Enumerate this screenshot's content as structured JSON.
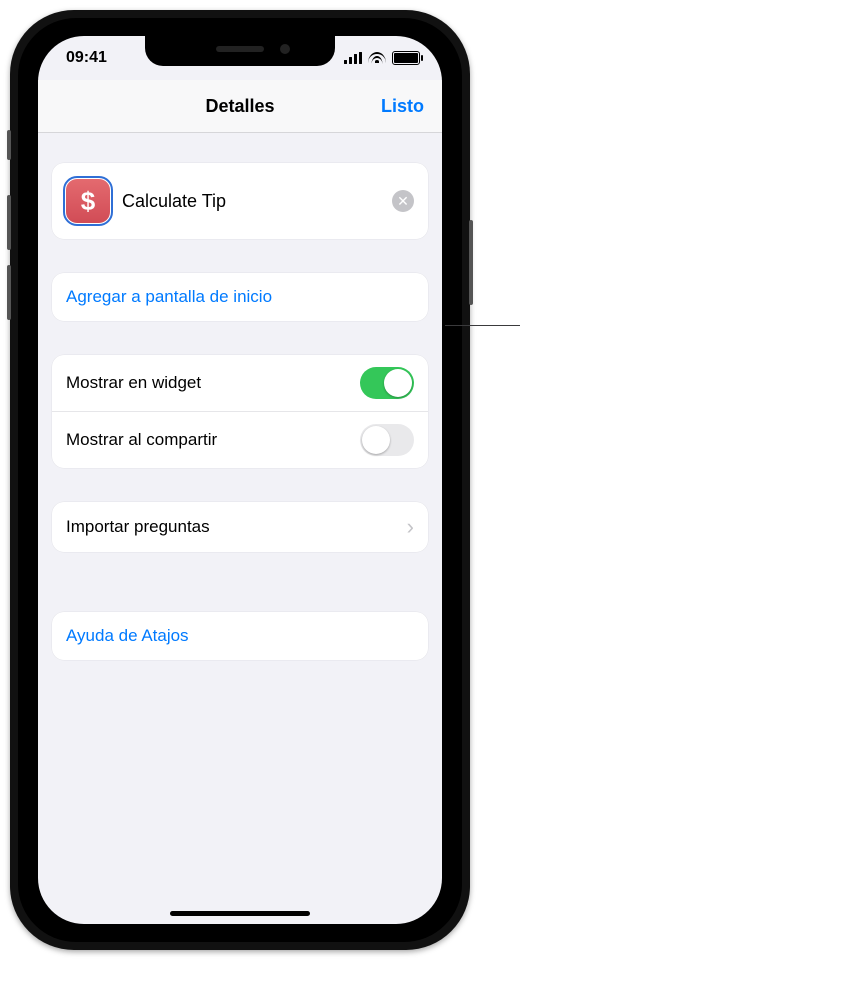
{
  "statusbar": {
    "time": "09:41"
  },
  "navbar": {
    "title": "Detalles",
    "done": "Listo"
  },
  "shortcut": {
    "icon_name": "dollar-sign-icon",
    "icon_glyph": "$",
    "name": "Calculate Tip"
  },
  "actions": {
    "add_to_home": "Agregar a pantalla de inicio"
  },
  "toggles": {
    "show_in_widget": {
      "label": "Mostrar en widget",
      "value": true
    },
    "show_in_share": {
      "label": "Mostrar al compartir",
      "value": false
    }
  },
  "import_questions": {
    "label": "Importar preguntas"
  },
  "help": {
    "label": "Ayuda de Atajos"
  }
}
